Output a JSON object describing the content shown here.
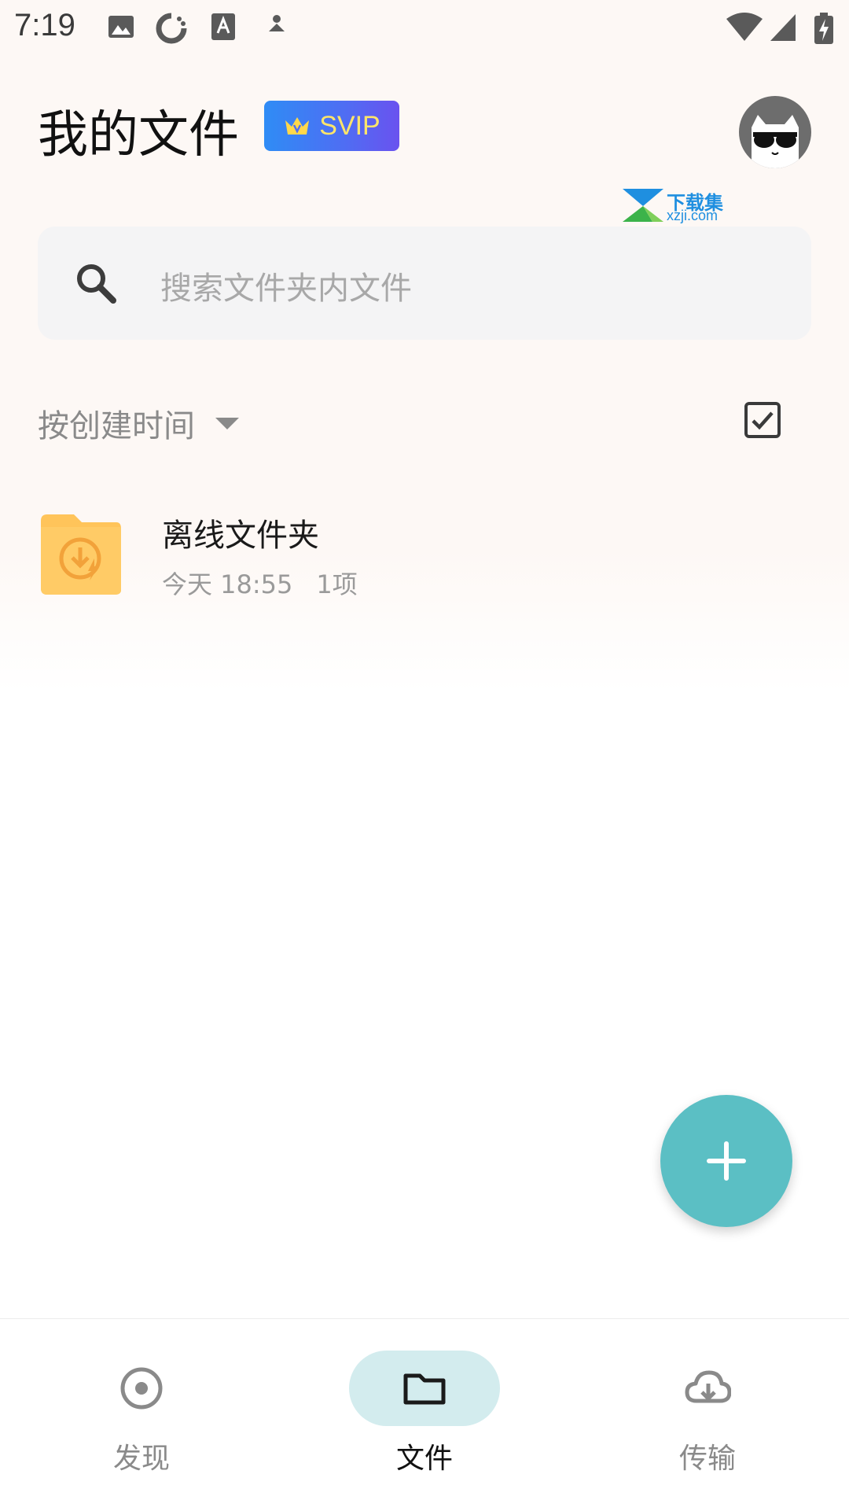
{
  "status_bar": {
    "time": "7:19",
    "icons": [
      "image-icon",
      "sync-icon",
      "a-icon",
      "person-icon",
      "wifi-icon",
      "signal-icon",
      "battery-charging-icon"
    ]
  },
  "header": {
    "title": "我的文件",
    "badge": "SVIP",
    "badge_icon": "crown-icon",
    "avatar_icon": "cat-avatar-icon"
  },
  "watermark": {
    "title": "下载集",
    "subtitle": "xzji.com"
  },
  "search": {
    "placeholder": "搜索文件夹内文件",
    "icon": "search-icon"
  },
  "sort": {
    "label": "按创建时间"
  },
  "files": [
    {
      "name": "离线文件夹",
      "date": "今天 18:55",
      "count": "1项",
      "icon": "offline-folder-icon"
    }
  ],
  "fab": {
    "icon": "plus-icon"
  },
  "bottom_nav": {
    "items": [
      {
        "label": "发现",
        "icon": "discover-icon",
        "active": false
      },
      {
        "label": "文件",
        "icon": "folder-icon",
        "active": true
      },
      {
        "label": "传输",
        "icon": "cloud-download-icon",
        "active": false
      }
    ]
  },
  "colors": {
    "accent": "#5bbfc4",
    "nav_active_bg": "#d3ecee",
    "svip_gradient_start": "#2f8cf5",
    "svip_gradient_end": "#6a52ef",
    "svip_text": "#ffe56a",
    "folder": "#ffc45a"
  }
}
